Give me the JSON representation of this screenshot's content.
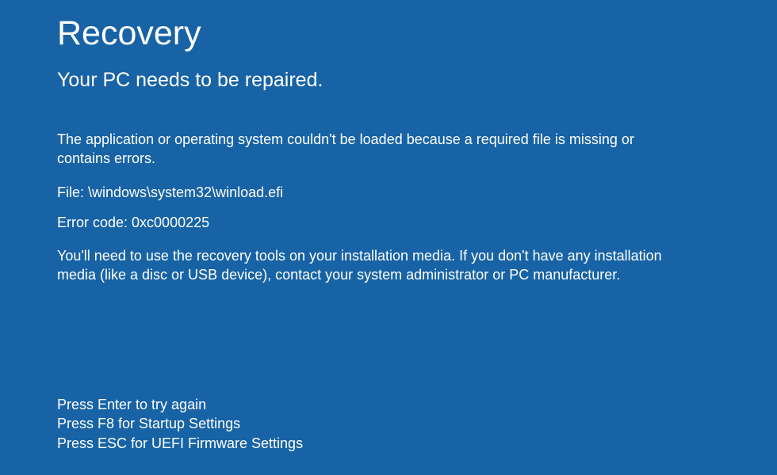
{
  "title": "Recovery",
  "subtitle": "Your PC needs to be repaired.",
  "message": "The application or operating system couldn't be loaded because a required file is missing or contains errors.",
  "file_line": "File: \\windows\\system32\\winload.efi",
  "error_line": "Error code: 0xc0000225",
  "advice": "You'll need to use the recovery tools on your installation media. If you don't have any installation media (like a disc or USB device), contact your system administrator or PC manufacturer.",
  "instructions": {
    "line1": "Press Enter to try again",
    "line2": "Press F8 for Startup Settings",
    "line3": "Press ESC for UEFI Firmware Settings"
  }
}
